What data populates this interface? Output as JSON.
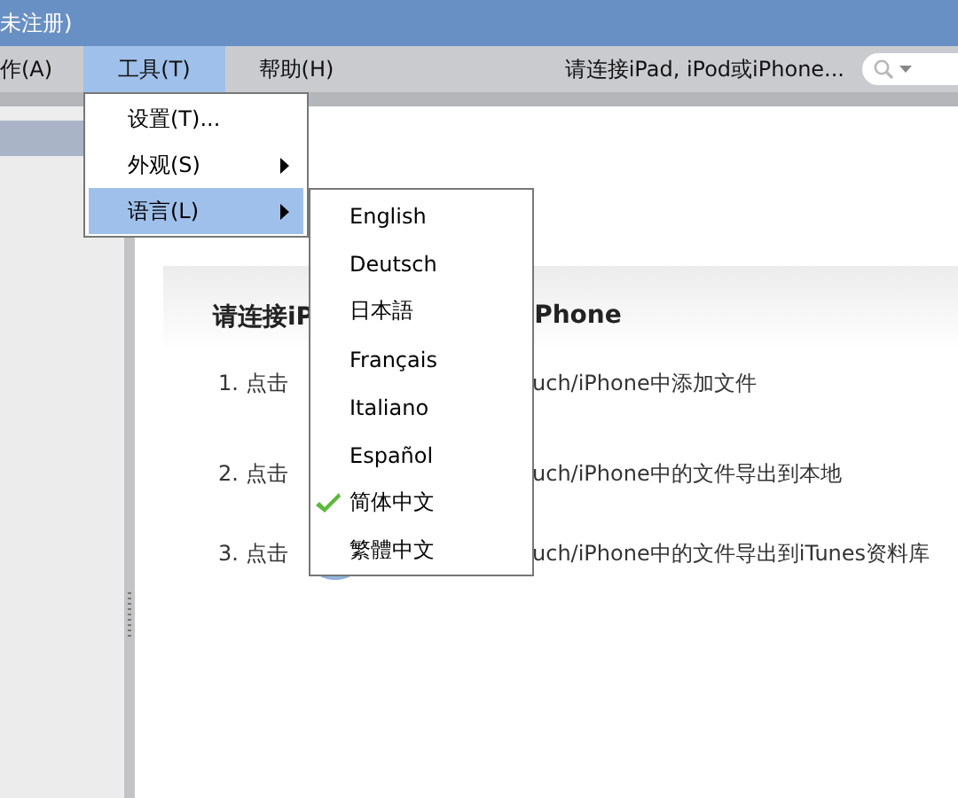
{
  "window": {
    "title": "未注册)"
  },
  "menu_bar": {
    "items": [
      {
        "label": "作(A)",
        "selected": false
      },
      {
        "label": "工具(T)",
        "selected": true
      },
      {
        "label": "帮助(H)",
        "selected": false
      }
    ],
    "status": "请连接iPad, iPod或iPhone..."
  },
  "tools_menu": {
    "items": [
      {
        "label": "设置(T)...",
        "submenu": false,
        "selected": false
      },
      {
        "label": "外观(S)",
        "submenu": true,
        "selected": false
      },
      {
        "label": "语言(L)",
        "submenu": true,
        "selected": true
      }
    ]
  },
  "language_menu": {
    "items": [
      {
        "label": "English",
        "checked": false
      },
      {
        "label": "Deutsch",
        "checked": false
      },
      {
        "label": "日本語",
        "checked": false
      },
      {
        "label": "Français",
        "checked": false
      },
      {
        "label": "Italiano",
        "checked": false
      },
      {
        "label": "Español",
        "checked": false
      },
      {
        "label": "简体中文",
        "checked": true
      },
      {
        "label": "繁體中文",
        "checked": false
      }
    ]
  },
  "content": {
    "connect_title": {
      "start": "请连接iP",
      "end": "Phone"
    },
    "steps": [
      {
        "number": "1. 点击",
        "text": "uch/iPhone中添加文件",
        "icon": false
      },
      {
        "number": "2. 点击",
        "text": "uch/iPhone中的文件导出到本地",
        "icon": false
      },
      {
        "number": "3. 点击",
        "text": "uch/iPhone中的文件导出到iTunes资料库",
        "icon": true
      }
    ]
  }
}
